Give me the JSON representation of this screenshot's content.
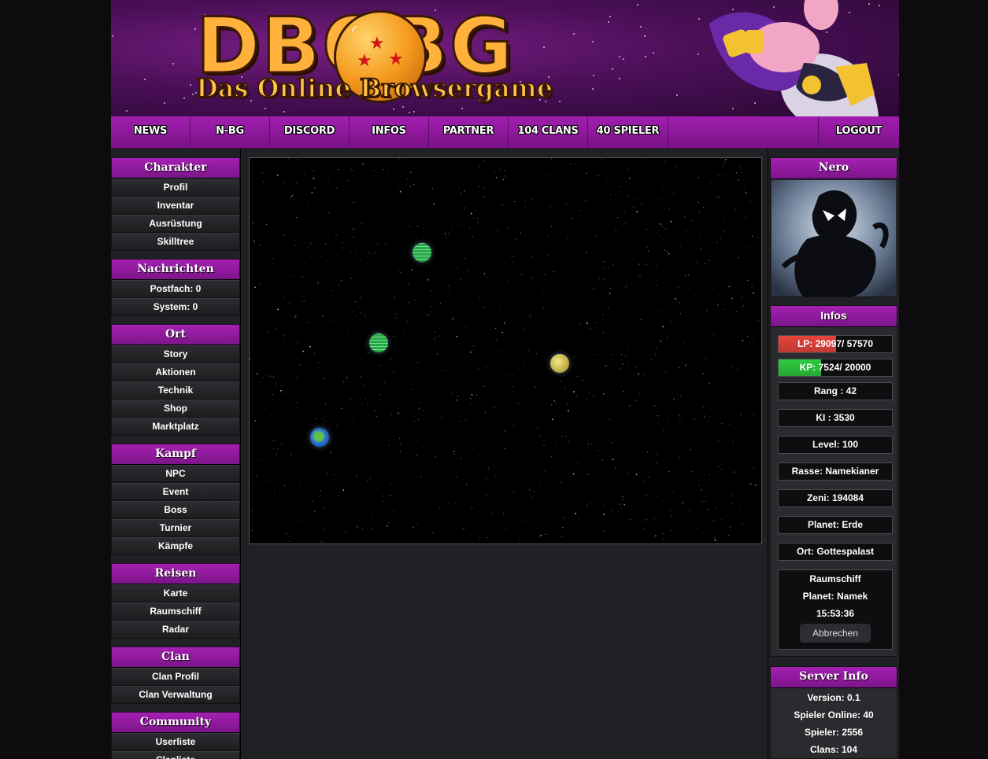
{
  "header": {
    "logo_title": "DBOBG",
    "logo_subtitle": "Das Online Browsergame"
  },
  "nav": {
    "items": [
      "NEWS",
      "N-BG",
      "DISCORD",
      "INFOS",
      "PARTNER",
      "104 CLANS",
      "40 SPIELER"
    ],
    "logout": "LOGOUT"
  },
  "sidebar": {
    "charakter": {
      "title": "Charakter",
      "items": [
        "Profil",
        "Inventar",
        "Ausrüstung",
        "Skilltree"
      ]
    },
    "nachrichten": {
      "title": "Nachrichten",
      "items": [
        "Postfach: 0",
        "System: 0"
      ]
    },
    "ort": {
      "title": "Ort",
      "items": [
        "Story",
        "Aktionen",
        "Technik",
        "Shop",
        "Marktplatz"
      ]
    },
    "kampf": {
      "title": "Kampf",
      "items": [
        "NPC",
        "Event",
        "Boss",
        "Turnier",
        "Kämpfe"
      ]
    },
    "reisen": {
      "title": "Reisen",
      "items": [
        "Karte",
        "Raumschiff",
        "Radar"
      ]
    },
    "clan": {
      "title": "Clan",
      "items": [
        "Clan Profil",
        "Clan Verwaltung"
      ]
    },
    "community": {
      "title": "Community",
      "items": [
        "Userliste",
        "Clanliste"
      ]
    }
  },
  "player": {
    "name": "Nero",
    "infos_title": "Infos",
    "lp": {
      "text": "LP: 29097/ 57570",
      "fraction": 0.505,
      "color": "#e8453c"
    },
    "kp": {
      "text": "KP: 7524/ 20000",
      "fraction": 0.376,
      "color": "#2ecc40"
    },
    "rang": "Rang : 42",
    "ki": "KI : 3530",
    "level": "Level: 100",
    "rasse": "Rasse: Namekianer",
    "zeni": "Zeni: 194084",
    "planet": "Planet: Erde",
    "ort": "Ort: Gottespalast"
  },
  "spaceship": {
    "title": "Raumschiff",
    "destination": "Planet: Namek",
    "time": "15:53:36",
    "cancel_label": "Abbrechen"
  },
  "server_info": {
    "title": "Server Info",
    "version": "Version: 0.1",
    "online": "Spieler Online: 40",
    "players": "Spieler: 2556",
    "clans": "Clans: 104"
  },
  "colors": {
    "accent_purple": "#9a1ca8",
    "background": "#202124"
  }
}
